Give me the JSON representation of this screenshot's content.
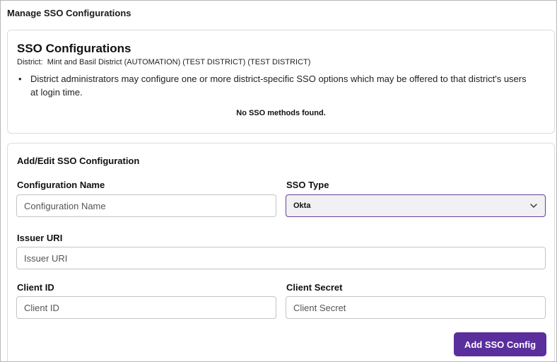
{
  "page": {
    "title": "Manage SSO Configurations"
  },
  "list_card": {
    "title": "SSO Configurations",
    "district_label": "District:",
    "district_name": "Mint and Basil District (AUTOMATION) (TEST DISTRICT) (TEST DISTRICT)",
    "bullet": "District administrators may configure one or more district-specific SSO options which may be offered to that district's users at login time.",
    "empty_message": "No SSO methods found."
  },
  "form": {
    "title": "Add/Edit SSO Configuration",
    "config_name": {
      "label": "Configuration Name",
      "placeholder": "Configuration Name",
      "value": ""
    },
    "sso_type": {
      "label": "SSO Type",
      "selected": "Okta"
    },
    "issuer_uri": {
      "label": "Issuer URI",
      "placeholder": "Issuer URI",
      "value": ""
    },
    "client_id": {
      "label": "Client ID",
      "placeholder": "Client ID",
      "value": ""
    },
    "client_secret": {
      "label": "Client Secret",
      "placeholder": "Client Secret",
      "value": ""
    },
    "submit_label": "Add SSO Config"
  },
  "colors": {
    "primary": "#5b2e9e",
    "select_border": "#6a3d9a",
    "card_border": "#dcdcdc"
  },
  "icons": {
    "select_arrow": "chevron-down-icon"
  }
}
